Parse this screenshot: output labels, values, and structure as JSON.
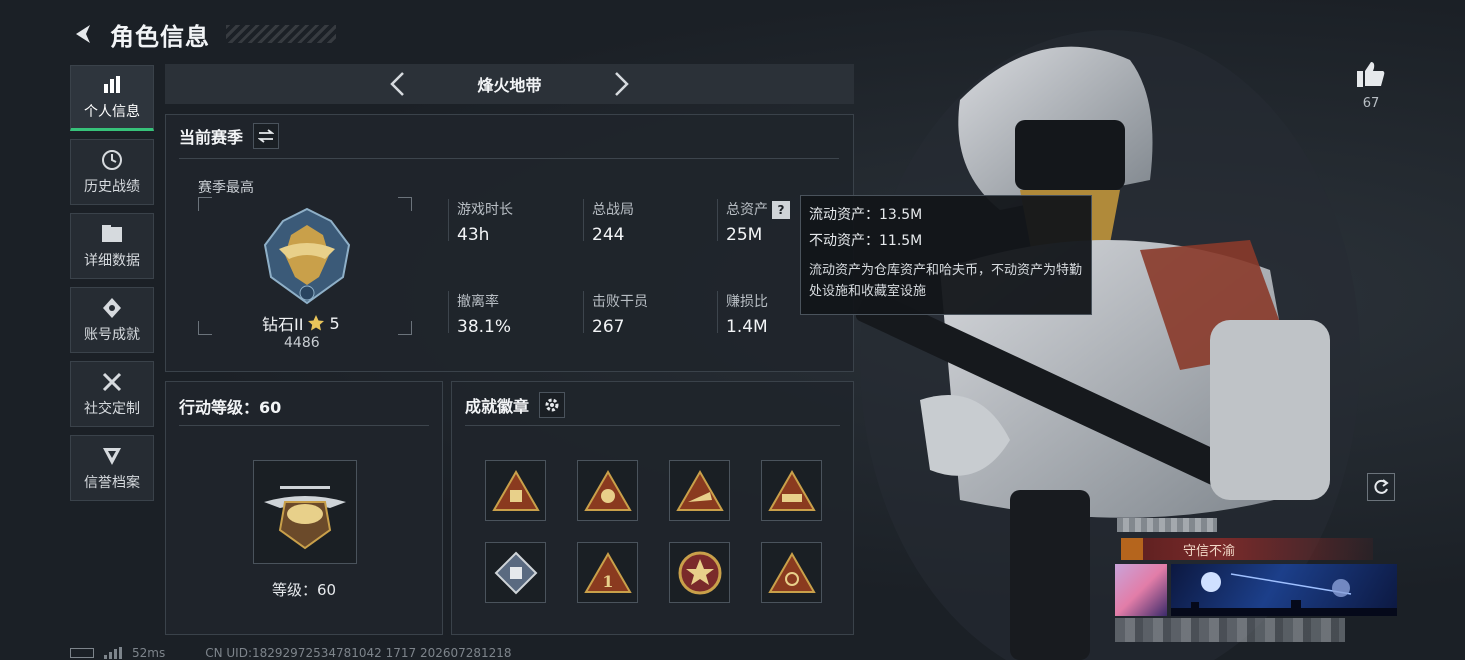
{
  "header": {
    "title": "角色信息"
  },
  "sidebar": {
    "items": [
      {
        "label": "个人信息",
        "icon": "bar-chart-icon",
        "active": true
      },
      {
        "label": "历史战绩",
        "icon": "history-icon",
        "active": false
      },
      {
        "label": "详细数据",
        "icon": "folder-icon",
        "active": false
      },
      {
        "label": "账号成就",
        "icon": "medal-icon",
        "active": false
      },
      {
        "label": "社交定制",
        "icon": "tools-icon",
        "active": false
      },
      {
        "label": "信誉档案",
        "icon": "shield-icon",
        "active": false
      }
    ]
  },
  "mode": {
    "name": "烽火地带"
  },
  "season": {
    "title": "当前赛季",
    "best_label": "赛季最高",
    "rank_name": "钻石II",
    "rank_stars": "5",
    "rank_score": "4486",
    "stats": [
      {
        "label": "游戏时长",
        "value": "43h"
      },
      {
        "label": "总战局",
        "value": "244"
      },
      {
        "label": "总资产",
        "value": "25M"
      },
      {
        "label": "撤离率",
        "value": "38.1%"
      },
      {
        "label": "击败干员",
        "value": "267"
      },
      {
        "label": "赚损比",
        "value": "1.4M"
      }
    ]
  },
  "tooltip": {
    "liquid": "流动资产：13.5M",
    "fixed": "不动资产：11.5M",
    "desc": "流动资产为仓库资产和哈夫币，不动资产为特勤处设施和收藏室设施"
  },
  "level": {
    "title": "行动等级：60",
    "level_text": "等级：60"
  },
  "badges": {
    "title": "成就徽章",
    "items": [
      "badge-icon",
      "badge-icon",
      "badge-icon",
      "badge-icon",
      "badge-icon",
      "badge-icon",
      "badge-icon",
      "badge-icon"
    ]
  },
  "like": {
    "count": "67"
  },
  "card": {
    "tag": "守信不渝"
  },
  "footer": {
    "ping": "52ms",
    "uid": "CN UID:18292972534781042 1717 202607281218"
  },
  "colors": {
    "accent": "#37c27a",
    "gold": "#c9a04a",
    "panel": "#20252b"
  }
}
